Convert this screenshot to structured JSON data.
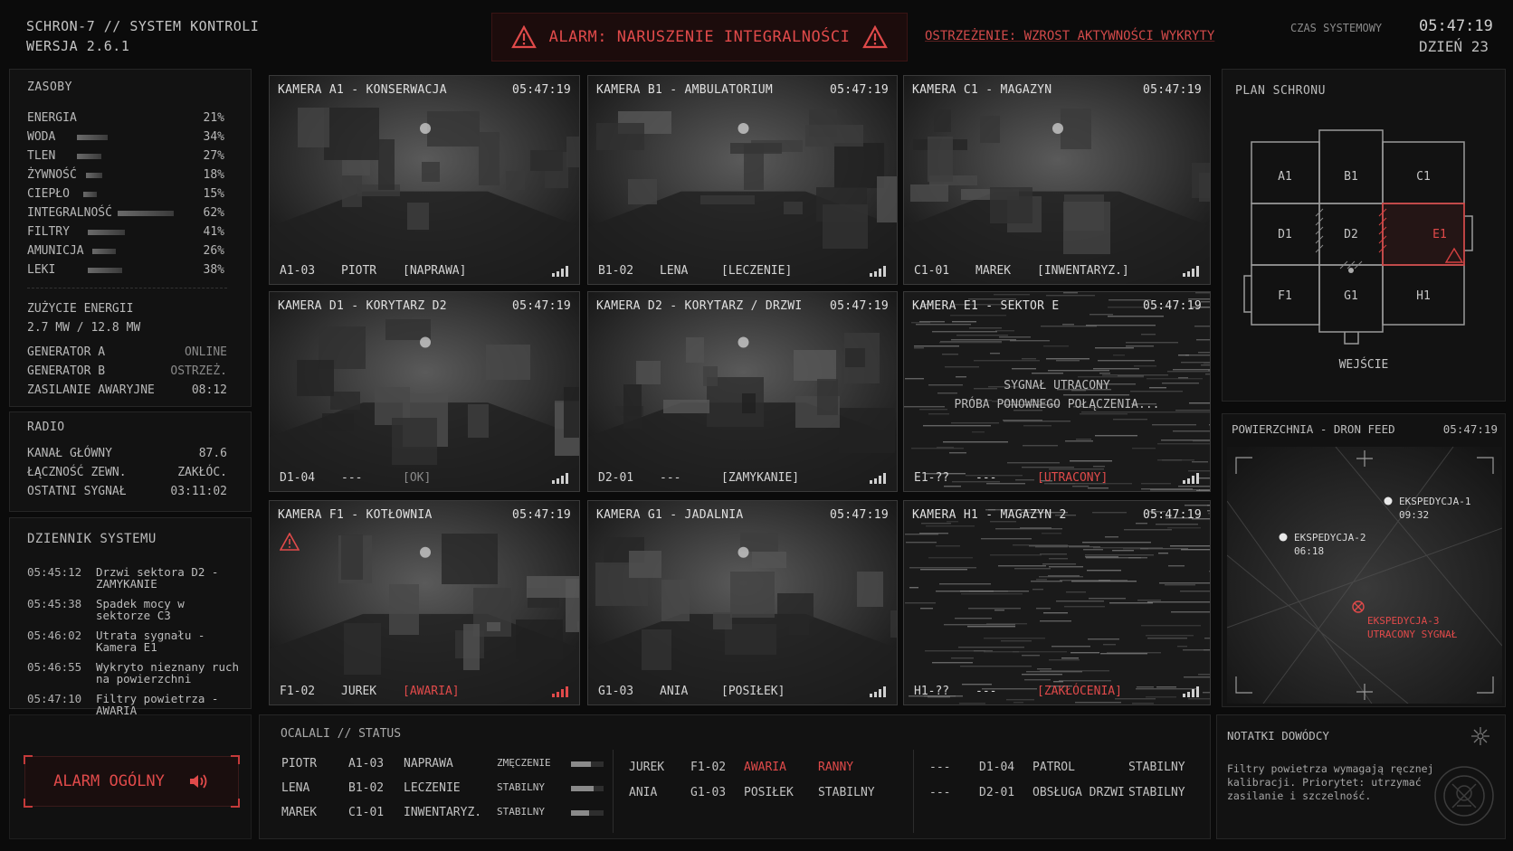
{
  "header": {
    "system_name": "SCHRON-7 // SYSTEM KONTROLI",
    "version": "WERSJA 2.6.1",
    "alarm_text": "ALARM: NARUSZENIE INTEGRALNOŚCI",
    "warning_text": "OSTRZEŻENIE: WZROST AKTYWNOŚCI WYKRYTY",
    "time_label": "CZAS SYSTEMOWY",
    "time_value": "05:47:19",
    "day_value": "DZIEŃ 23"
  },
  "resources": {
    "title": "ZASOBY",
    "items": [
      {
        "name": "ENERGIA",
        "value": "21%",
        "level": 0.21
      },
      {
        "name": "WODA",
        "value": "34%",
        "level": 0.34
      },
      {
        "name": "TLEN",
        "value": "27%",
        "level": 0.27
      },
      {
        "name": "ŻYWNOŚĆ",
        "value": "18%",
        "level": 0.18
      },
      {
        "name": "CIEPŁO",
        "value": "15%",
        "level": 0.15
      },
      {
        "name": "INTEGRALNOŚĆ",
        "value": "62%",
        "level": 0.62
      },
      {
        "name": "FILTRY",
        "value": "41%",
        "level": 0.41
      },
      {
        "name": "AMUNICJA",
        "value": "26%",
        "level": 0.26
      },
      {
        "name": "LEKI",
        "value": "38%",
        "level": 0.38
      }
    ],
    "energy_title": "ZUŻYCIE ENERGII",
    "energy_value": "2.7 MW / 12.8 MW",
    "generators": [
      {
        "name": "GENERATOR A",
        "status": "ONLINE"
      },
      {
        "name": "GENERATOR B",
        "status": "OSTRZEŻ."
      },
      {
        "name": "ZASILANIE AWARYJNE",
        "status": "08:12"
      }
    ]
  },
  "radio": {
    "title": "RADIO",
    "items": [
      {
        "name": "KANAŁ GŁÓWNY",
        "value": "87.6"
      },
      {
        "name": "ŁĄCZNOŚĆ ZEWN.",
        "value": "ZAKŁÓC."
      },
      {
        "name": "OSTATNI SYGNAŁ",
        "value": "03:11:02"
      }
    ]
  },
  "log": {
    "title": "DZIENNIK SYSTEMU",
    "items": [
      {
        "time": "05:45:12",
        "msg": "Drzwi sektora D2 - ZAMYKANIE"
      },
      {
        "time": "05:45:38",
        "msg": "Spadek mocy w sektorze C3"
      },
      {
        "time": "05:46:02",
        "msg": "Utrata sygnału - Kamera E1"
      },
      {
        "time": "05:46:55",
        "msg": "Wykryto nieznany ruch na powierzchni"
      },
      {
        "time": "05:47:10",
        "msg": "Filtry powietrza - AWARIA"
      }
    ]
  },
  "alarm_button": "ALARM OGÓLNY",
  "cameras": [
    {
      "title": "KAMERA A1 - KONSERWACJA",
      "time": "05:47:19",
      "id": "A1-03",
      "person": "PIOTR",
      "status": "[NAPRAWA]",
      "alert": false,
      "lost": false
    },
    {
      "title": "KAMERA B1 - AMBULATORIUM",
      "time": "05:47:19",
      "id": "B1-02",
      "person": "LENA",
      "status": "[LECZENIE]",
      "alert": false,
      "lost": false
    },
    {
      "title": "KAMERA C1 - MAGAZYN",
      "time": "05:47:19",
      "id": "C1-01",
      "person": "MAREK",
      "status": "[INWENTARYZ.]",
      "alert": false,
      "lost": false
    },
    {
      "title": "KAMERA D1 - KORYTARZ D2",
      "time": "05:47:19",
      "id": "D1-04",
      "person": "---",
      "status": "[OK]",
      "alert": false,
      "lost": false
    },
    {
      "title": "KAMERA D2 - KORYTARZ / DRZWI",
      "time": "05:47:19",
      "id": "D2-01",
      "person": "---",
      "status": "[ZAMYKANIE]",
      "alert": false,
      "lost": false
    },
    {
      "title": "KAMERA E1 - SEKTOR E",
      "time": "05:47:19",
      "id": "E1-??",
      "person": "---",
      "status": "[UTRACONY]",
      "alert": true,
      "lost": true,
      "lost_line1": "SYGNAŁ UTRACONY",
      "lost_line2": "PRÓBA PONOWNEGO POŁĄCZENIA..."
    },
    {
      "title": "KAMERA F1 - KOTŁOWNIA",
      "time": "05:47:19",
      "id": "F1-02",
      "person": "JUREK",
      "status": "[AWARIA]",
      "alert": true,
      "lost": false,
      "warn": true
    },
    {
      "title": "KAMERA G1 - JADALNIA",
      "time": "05:47:19",
      "id": "G1-03",
      "person": "ANIA",
      "status": "[POSIŁEK]",
      "alert": false,
      "lost": false
    },
    {
      "title": "KAMERA H1 - MAGAZYN 2",
      "time": "05:47:19",
      "id": "H1-??",
      "person": "---",
      "status": "[ZAKŁÓCENIA]",
      "alert": true,
      "lost": true
    }
  ],
  "map": {
    "title": "PLAN SCHRONU",
    "rooms": [
      "A1",
      "B1",
      "C1",
      "D1",
      "D2",
      "E1",
      "F1",
      "G1",
      "H1"
    ],
    "entrance": "WEJŚCIE"
  },
  "drone": {
    "title": "POWIERZCHNIA - DRON FEED",
    "time": "05:47:19",
    "markers": [
      {
        "name": "EKSPEDYCJA-1",
        "time": "09:32"
      },
      {
        "name": "EKSPEDYCJA-2",
        "time": "06:18"
      },
      {
        "name": "EKSPEDYCJA-3",
        "time": "UTRACONY SYGNAŁ"
      }
    ]
  },
  "survivors": {
    "title": "OCALALI // STATUS",
    "group1": [
      {
        "name": "PIOTR",
        "loc": "A1-03",
        "task": "NAPRAWA",
        "state": "ZMĘCZENIE",
        "level": 0.6
      },
      {
        "name": "LENA",
        "loc": "B1-02",
        "task": "LECZENIE",
        "state": "STABILNY",
        "level": 0.7
      },
      {
        "name": "MAREK",
        "loc": "C1-01",
        "task": "INWENTARYZ.",
        "state": "STABILNY",
        "level": 0.55
      }
    ],
    "group2": [
      {
        "name": "JUREK",
        "loc": "F1-02",
        "task": "AWARIA",
        "state": "RANNY"
      },
      {
        "name": "ANIA",
        "loc": "G1-03",
        "task": "POSIŁEK",
        "state": "STABILNY"
      }
    ],
    "group3": [
      {
        "name": "---",
        "loc": "D1-04",
        "task": "PATROL",
        "state": "STABILNY"
      },
      {
        "name": "---",
        "loc": "D2-01",
        "task": "OBSŁUGA DRZWI",
        "state": "STABILNY"
      }
    ]
  },
  "notes": {
    "title": "NOTATKI DOWÓDCY",
    "text": "Filtry powietrza wymagają ręcznej kalibracji. Priorytet: utrzymać zasilanie i szczelność."
  }
}
